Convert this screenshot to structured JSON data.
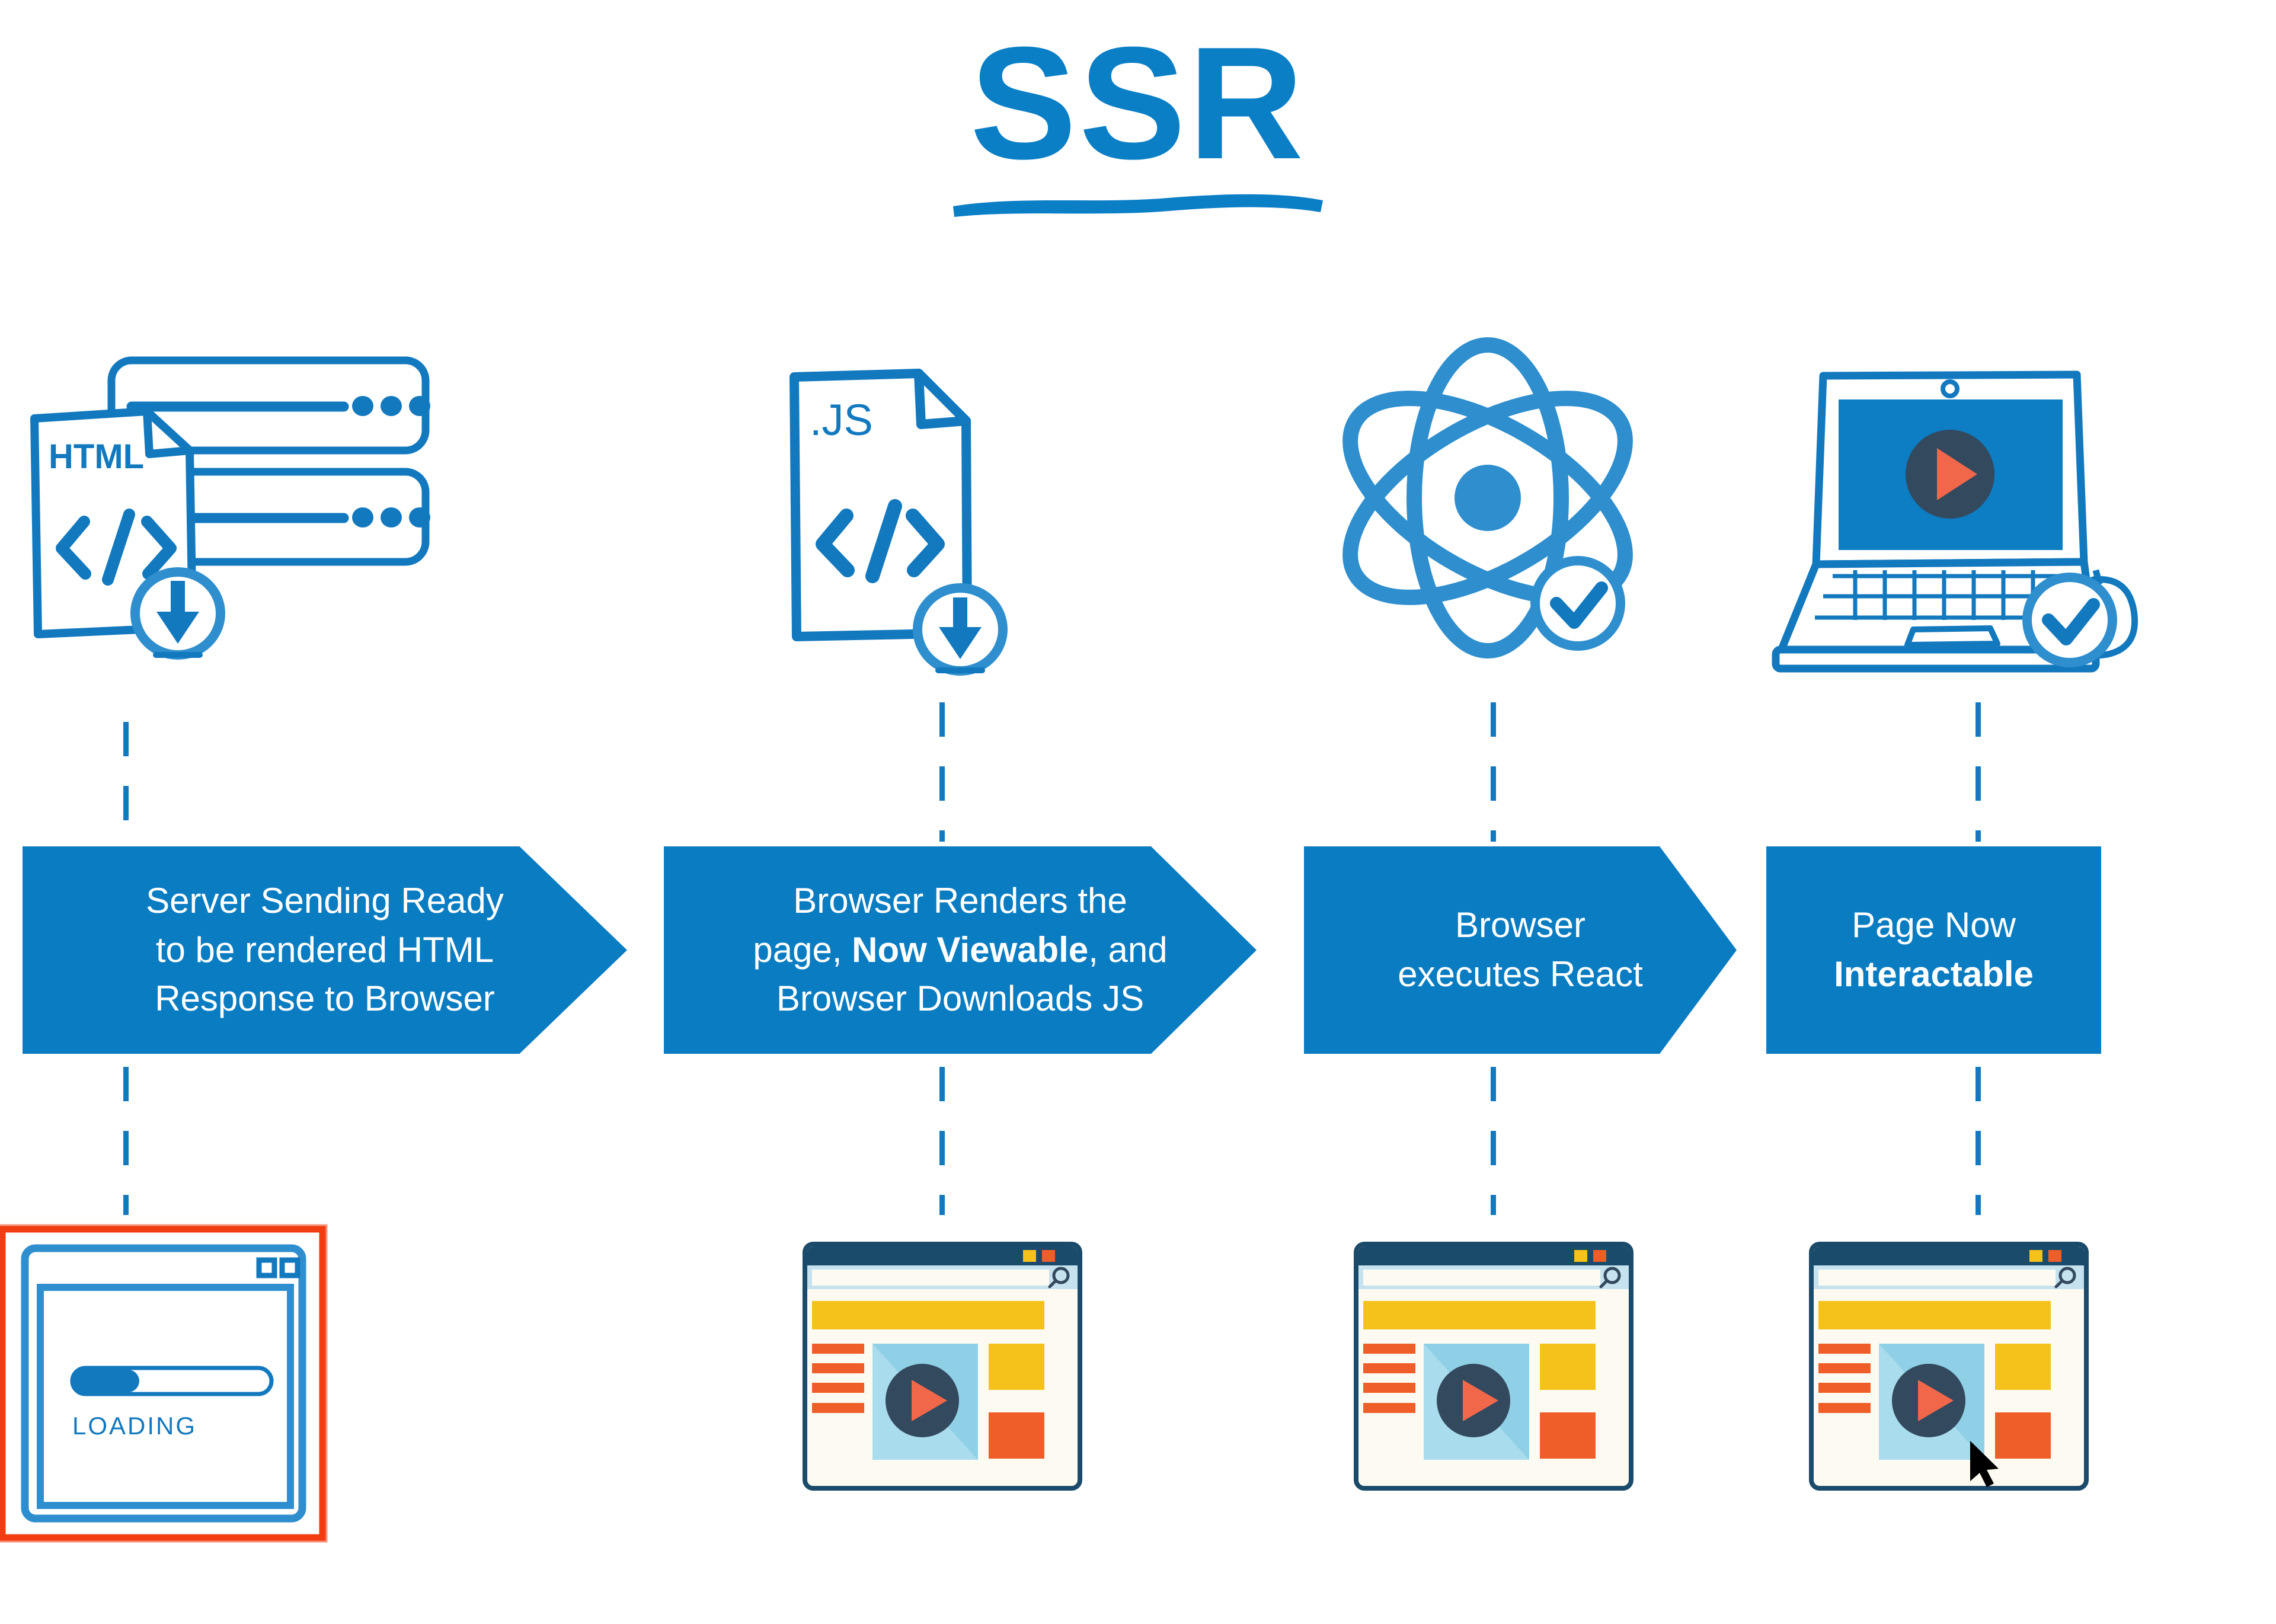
{
  "title": {
    "text": "SSR",
    "underline_icon": "hand-drawn-swoosh-underline"
  },
  "accent_colors": {
    "brand_blue": "#0A7CC2",
    "sketch_blue": "#1379BF",
    "alert_red": "#F23D12",
    "mock_navy": "#1B4B6B",
    "mock_yellow": "#F5C21B",
    "mock_orange": "#EF5E28",
    "mock_lightblue": "#8FD0E6",
    "mock_cream": "#FDFBF1",
    "play_dark": "#33495E",
    "play_triangle": "#F0674A"
  },
  "steps": [
    {
      "id": "step-1",
      "icon_name": "server-with-html-document-download-icon",
      "icon_labels": {
        "doc_label": "HTML",
        "code_glyph": "</>"
      },
      "banner_shape": "arrow",
      "banner_lines": [
        {
          "text": "Server Sending Ready",
          "bold": false
        },
        {
          "text": "to be rendered HTML",
          "bold": false
        },
        {
          "text": "Response to Browser",
          "bold": false
        }
      ],
      "mock_name": "loading-browser-window",
      "mock_label": "LOADING",
      "mock_progress_percent": 33,
      "mock_highlighted": true
    },
    {
      "id": "step-2",
      "icon_name": "js-file-download-icon",
      "icon_labels": {
        "doc_label": ".JS",
        "code_glyph": "</>"
      },
      "banner_shape": "arrow",
      "banner_lines": [
        {
          "text": "Browser Renders the",
          "bold": false
        },
        {
          "text": "page, ",
          "bold_part": "Now Viewable",
          "text_after": ", and",
          "bold": "partial"
        },
        {
          "text": "Browser Downloads JS",
          "bold": false
        }
      ],
      "mock_name": "rendered-page-browser-window",
      "mock_has_cursor": false,
      "mock_highlighted": false
    },
    {
      "id": "step-3",
      "icon_name": "react-atom-check-icon",
      "icon_labels": {},
      "banner_shape": "arrow",
      "banner_lines": [
        {
          "text": "Browser",
          "bold": false
        },
        {
          "text": "executes React",
          "bold": false
        }
      ],
      "mock_name": "rendered-page-browser-window",
      "mock_has_cursor": false,
      "mock_highlighted": false
    },
    {
      "id": "step-4",
      "icon_name": "laptop-with-mouse-check-icon",
      "icon_labels": {},
      "banner_shape": "rectangle",
      "banner_lines": [
        {
          "text": "Page Now",
          "bold": false
        },
        {
          "text": "Interactable",
          "bold": true
        }
      ],
      "mock_name": "interactive-page-browser-window",
      "mock_has_cursor": true,
      "mock_highlighted": false
    }
  ]
}
